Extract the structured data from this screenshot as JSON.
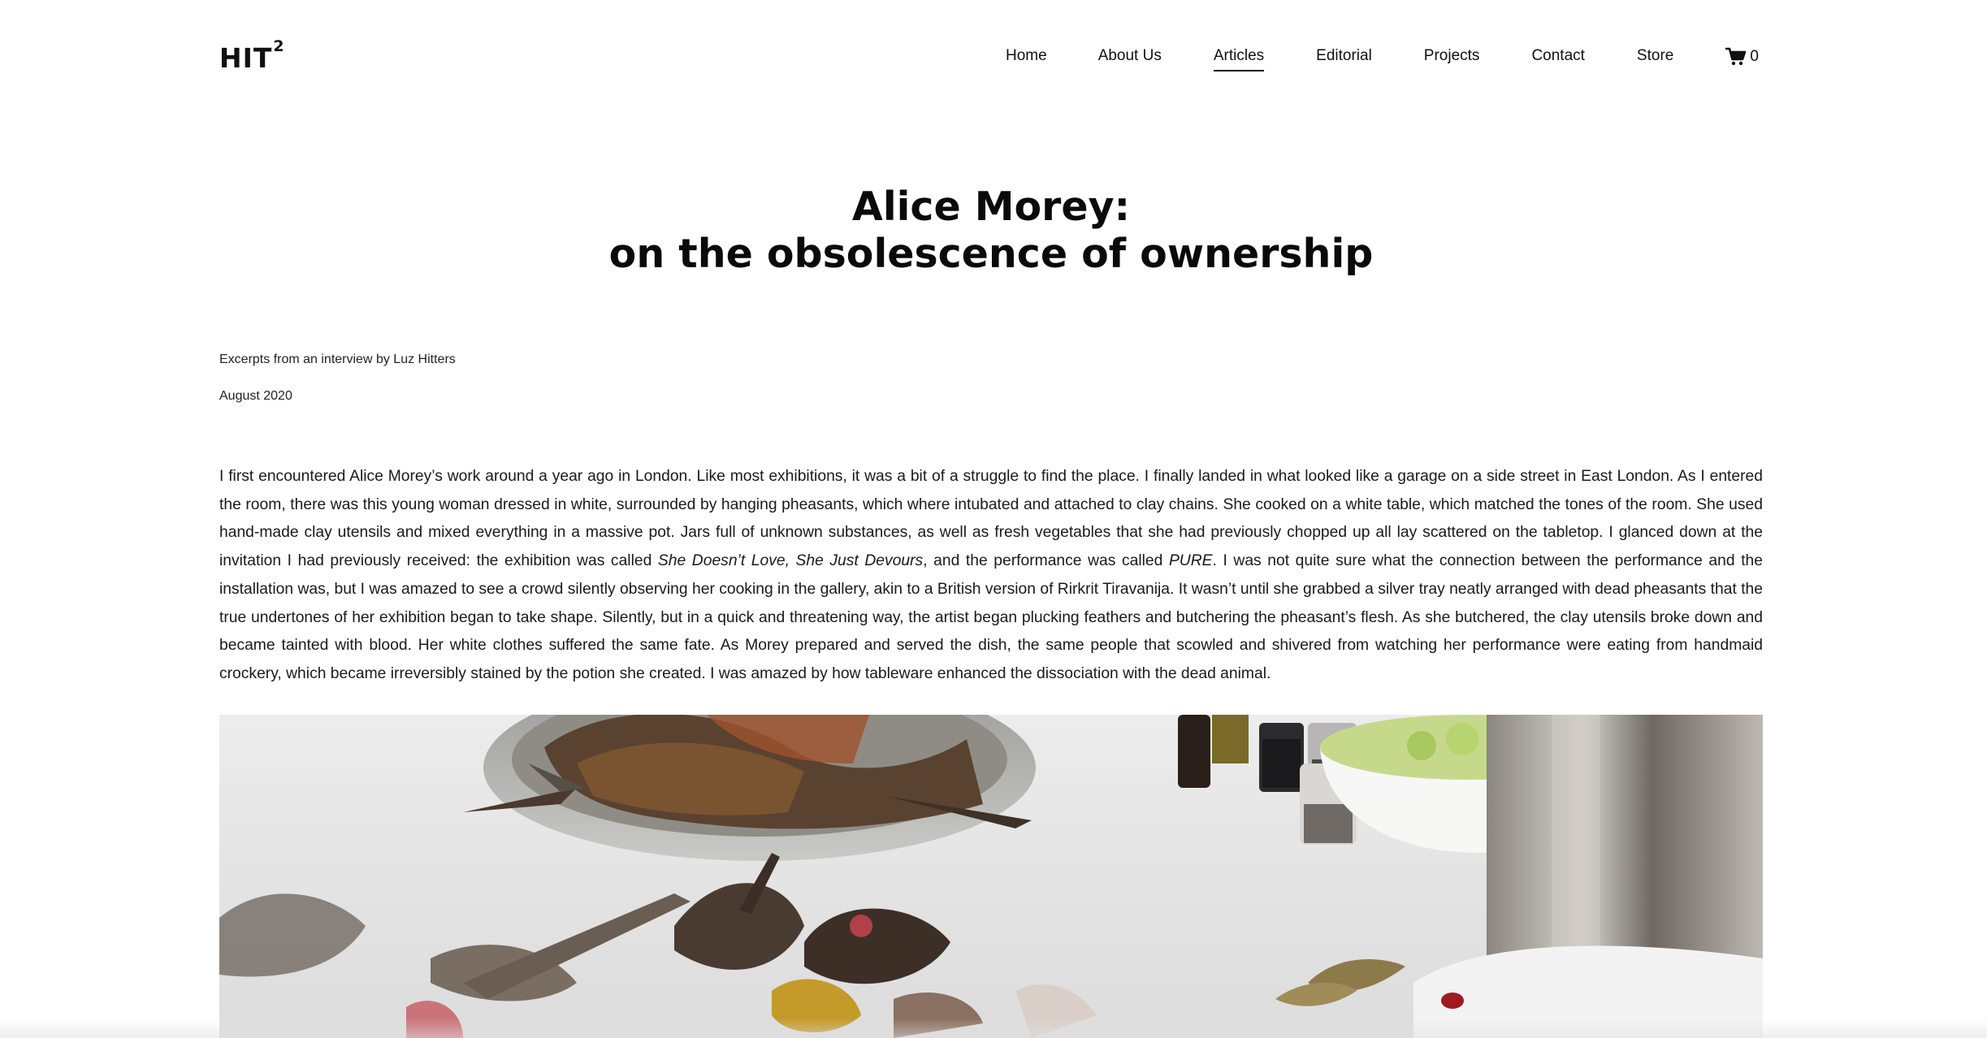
{
  "header": {
    "logo": "HIT",
    "logo_sup": "2",
    "nav": [
      {
        "label": "Home",
        "active": false
      },
      {
        "label": "About Us",
        "active": false
      },
      {
        "label": "Articles",
        "active": true
      },
      {
        "label": "Editorial",
        "active": false
      },
      {
        "label": "Projects",
        "active": false
      },
      {
        "label": "Contact",
        "active": false
      },
      {
        "label": "Store",
        "active": false
      }
    ],
    "cart_icon": "shopping-cart-icon",
    "cart_count": "0"
  },
  "article": {
    "title_line1": "Alice Morey:",
    "title_line2": "on the obsolescence of ownership",
    "byline": "Excerpts from an interview by Luz Hitters",
    "date": "August 2020",
    "para_part1": "I first encountered Alice Morey’s work around a year ago in London. Like most exhibitions, it was a bit of a struggle to find the place. I finally landed in what looked like a garage on a side street in East London. As I entered the room, there was this young woman dressed in white, surrounded by hanging pheasants, which where intubated and attached to clay chains. She cooked on a white table, which matched the tones of the room. She used hand-made clay utensils and mixed everything in a massive pot. Jars full of unknown substances, as well as fresh vegetables that she had previously chopped up all lay scattered on the tabletop. I glanced down at the invitation I had previously received: the exhibition was called ",
    "exhibition_title": "She Doesn’t Love, She Just Devours",
    "para_part2": ", and the performance was called ",
    "performance_title": "PURE",
    "para_part3": ". I was not quite sure what the connection between the performance and the installation was, but I was amazed to see a crowd silently observing her cooking in the gallery, akin to a British version of Rirkrit Tiravanija. It wasn’t until she grabbed a silver tray neatly arranged with dead pheasants that the true undertones of her exhibition began to take shape. Silently, but in a quick and threatening way, the artist began plucking feathers and butchering the pheasant’s flesh. As she butchered, the clay utensils broke down and became tainted with blood. Her white clothes suffered the same fate. As Morey prepared and served the dish, the same people that scowled and shivered from watching her performance were eating from handmaid crockery, which became irreversibly stained by the potion she created. I was amazed by how tableware enhanced the dissociation with the dead animal."
  },
  "colors": {
    "text": "#111111",
    "background": "#ffffff"
  }
}
